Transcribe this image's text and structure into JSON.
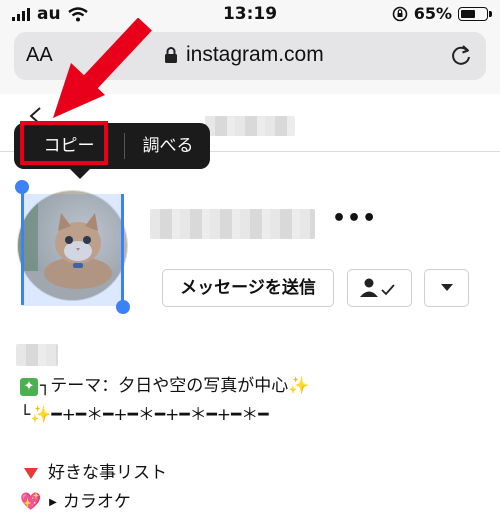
{
  "status_bar": {
    "carrier": "au",
    "time": "13:19",
    "battery_percent": "65%",
    "battery_level": 0.65
  },
  "address_bar": {
    "text_size_label": "AA",
    "domain": "instagram.com"
  },
  "context_menu": {
    "copy": "コピー",
    "look_up": "調べる"
  },
  "profile": {
    "actions": {
      "message": "メッセージを送信"
    }
  },
  "bio": {
    "line1": "テーマ：夕日や空の写真が中心",
    "line2": "━+━＊━+━＊━+━＊━+━＊━",
    "list_title": "好きな事リスト",
    "list_item_1": "カラオケ"
  },
  "colors": {
    "highlight": "#e8001a",
    "selection": "#3b82f6",
    "menu_bg": "#1b1b1b"
  }
}
